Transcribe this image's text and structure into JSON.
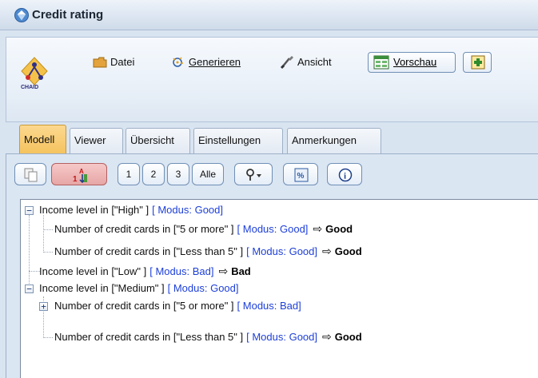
{
  "window": {
    "title": "Credit rating"
  },
  "model_icon": {
    "name": "chaid-icon",
    "label": "CHAID"
  },
  "menu": {
    "file": "Datei",
    "generate": "Generieren",
    "view": "Ansicht",
    "preview": "Vorschau"
  },
  "tabs": [
    {
      "label": "Modell",
      "active": true
    },
    {
      "label": "Viewer",
      "active": false
    },
    {
      "label": "Übersicht",
      "active": false
    },
    {
      "label": "Einstellungen",
      "active": false
    },
    {
      "label": "Anmerkungen",
      "active": false
    }
  ],
  "tree_toolbar": {
    "level_1": "1",
    "level_2": "2",
    "level_3": "3",
    "all": "Alle"
  },
  "tree": [
    {
      "rule": "Income level in [\"High\" ]",
      "mode": "[ Modus: Good]",
      "result": "",
      "expanded": true
    },
    {
      "rule": "Number of credit cards in [\"5 or more\" ]",
      "mode": "[ Modus: Good]",
      "result": "Good"
    },
    {
      "rule": "Number of credit cards in [\"Less than 5\" ]",
      "mode": "[ Modus: Good]",
      "result": "Good"
    },
    {
      "rule": "Income level in [\"Low\" ]",
      "mode": "[ Modus: Bad]",
      "result": "Bad"
    },
    {
      "rule": "Income level in [\"Medium\" ]",
      "mode": "[ Modus: Good]",
      "result": "",
      "expanded": true
    },
    {
      "rule": "Number of credit cards in [\"5 or more\" ]",
      "mode": "[ Modus: Bad]",
      "result": "",
      "expanded": false
    },
    {
      "rule": "Number of credit cards in [\"Less than 5\" ]",
      "mode": "[ Modus: Good]",
      "result": "Good"
    }
  ],
  "colors": {
    "mode_text": "#1d3fd8",
    "active_tab": "#f5c35f",
    "panel_bg": "#dbe6f3"
  }
}
